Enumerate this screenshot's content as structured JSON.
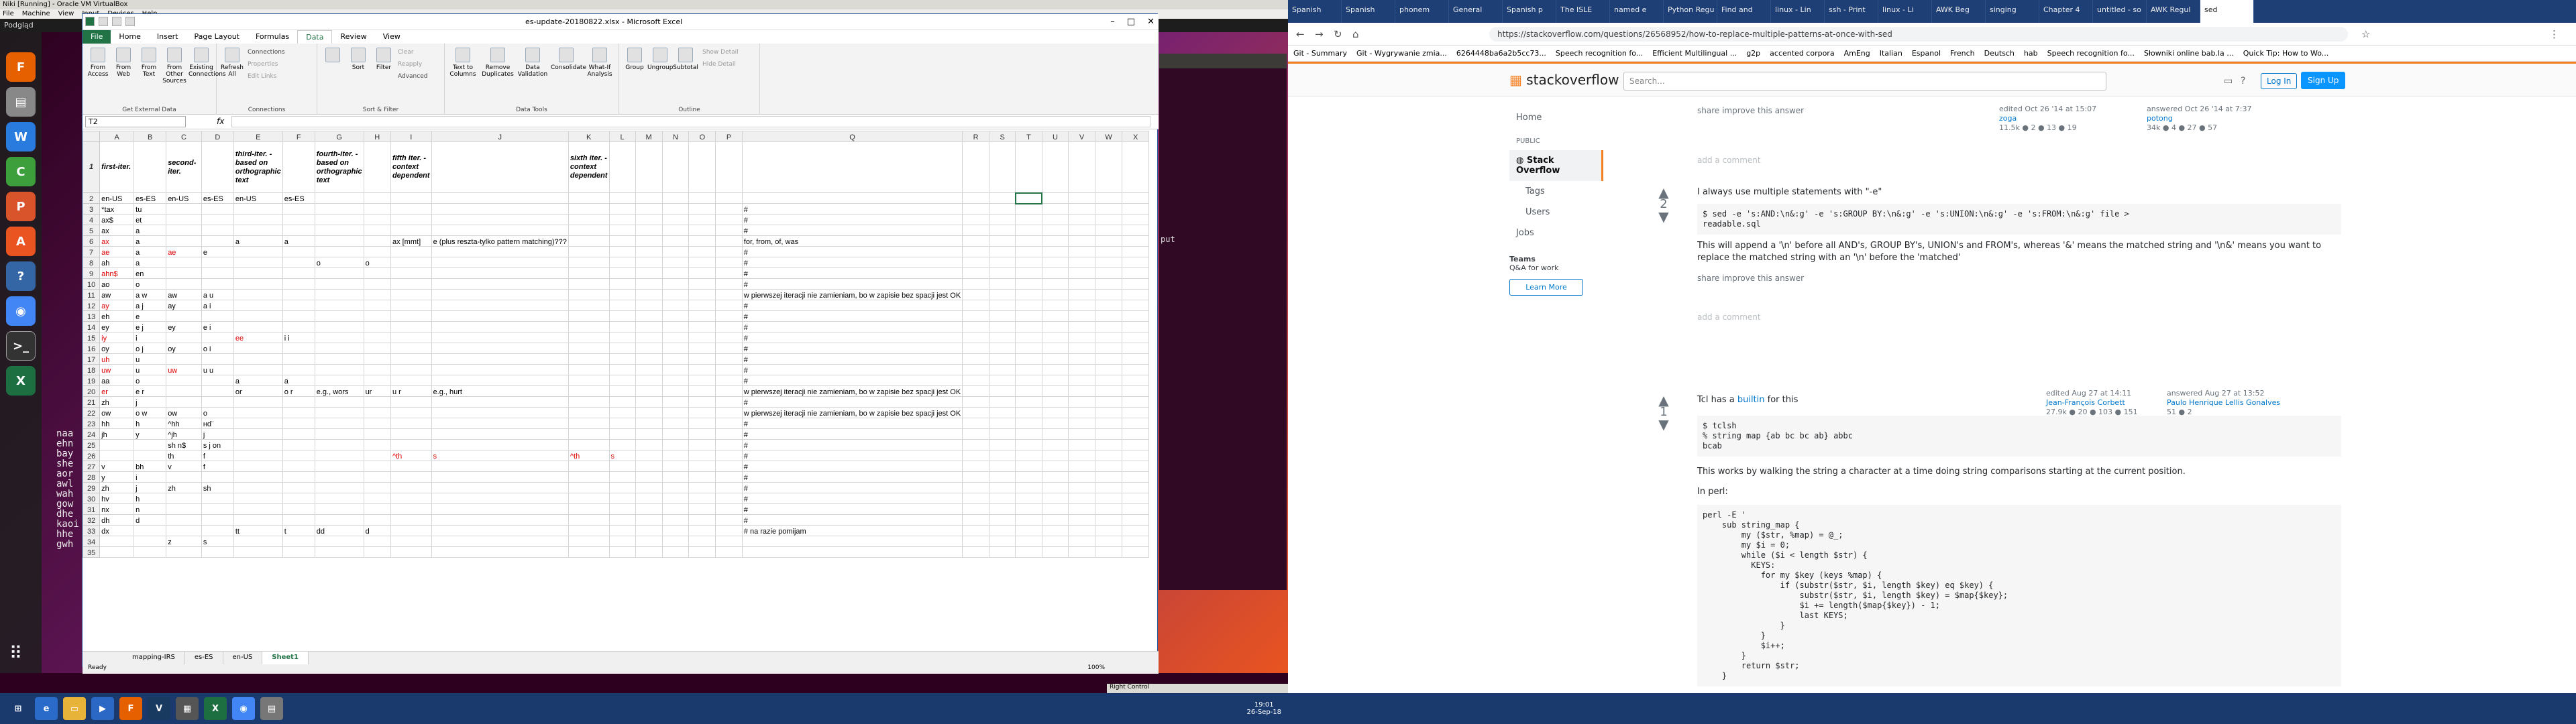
{
  "vbox": {
    "title": "Niki [Running] - Oracle VM VirtualBox",
    "menu": [
      "File",
      "Machine",
      "View",
      "Input",
      "Devices",
      "Help"
    ],
    "top_left": "Podgląd"
  },
  "terminal": {
    "left_text": [
      "naa",
      "ehn",
      "bay",
      "she",
      "aor",
      "awl",
      "wah",
      "gow",
      "dhe",
      "kaoi",
      "hhe",
      "gwh"
    ],
    "right_text": "put"
  },
  "excel": {
    "title": "es-update-20180822.xlsx - Microsoft Excel",
    "tabs": [
      "File",
      "Home",
      "Insert",
      "Page Layout",
      "Formulas",
      "Data",
      "Review",
      "View"
    ],
    "active_tab": "Data",
    "ribbon_groups": [
      {
        "label": "Get External Data",
        "buttons": [
          "From Access",
          "From Web",
          "From Text",
          "From Other Sources",
          "Existing Connections"
        ]
      },
      {
        "label": "Connections",
        "buttons": [
          "Refresh All"
        ],
        "small": [
          "Connections",
          "Properties",
          "Edit Links"
        ]
      },
      {
        "label": "Sort & Filter",
        "buttons": [
          "Sort",
          "Filter"
        ],
        "small": [
          "Clear",
          "Reapply",
          "Advanced"
        ]
      },
      {
        "label": "Data Tools",
        "buttons": [
          "Text to Columns",
          "Remove Duplicates",
          "Data Validation",
          "Consolidate",
          "What-If Analysis"
        ]
      },
      {
        "label": "Outline",
        "buttons": [
          "Group",
          "Ungroup",
          "Subtotal"
        ],
        "small": [
          "Show Detail",
          "Hide Detail"
        ]
      }
    ],
    "name_box": "T2",
    "fx": "fx",
    "columns": [
      "A",
      "B",
      "C",
      "D",
      "E",
      "F",
      "G",
      "H",
      "I",
      "J",
      "K",
      "L",
      "M",
      "N",
      "O",
      "P",
      "Q",
      "R",
      "S",
      "T",
      "U",
      "V",
      "W",
      "X"
    ],
    "header_row": [
      "first-iter.",
      "",
      "second-iter.",
      "",
      "third-iter. - based on orthographic text",
      "",
      "fourth-iter. - based on orthographic text",
      "",
      "fifth iter. - context dependent",
      "",
      "sixth iter. - context dependent"
    ],
    "rows": [
      [
        "en-US",
        "es-ES",
        "en-US",
        "es-ES",
        "en-US",
        "es-ES",
        "",
        "",
        "",
        "",
        "",
        "",
        "",
        "",
        "",
        ""
      ],
      [
        "*tax",
        "tu",
        "",
        "",
        "",
        "",
        "",
        "",
        "",
        "",
        "",
        "",
        "",
        "",
        "",
        "",
        "#"
      ],
      [
        "ax$",
        "et",
        "",
        "",
        "",
        "",
        "",
        "",
        "",
        "",
        "",
        "",
        "",
        "",
        "",
        "",
        "#"
      ],
      [
        "ax",
        "a",
        "",
        "",
        "",
        "",
        "",
        "",
        "",
        "",
        "",
        "",
        "",
        "",
        "",
        "",
        "#"
      ],
      [
        "ax",
        "a",
        "",
        "",
        "a",
        "a",
        "",
        "",
        "ax [mmt]",
        "e (plus reszta-tylko pattern matching)???",
        "",
        "",
        "",
        "",
        "",
        "",
        "for, from, of, was"
      ],
      [
        "ae",
        "a",
        "ae",
        "e",
        "",
        "",
        "",
        "",
        "",
        "",
        "",
        "",
        "",
        "",
        "",
        "",
        "#"
      ],
      [
        "ah",
        "a",
        "",
        "",
        "",
        "",
        "o",
        "o",
        "",
        "",
        "",
        "",
        "",
        "",
        "",
        "",
        "#"
      ],
      [
        "ahn$",
        "en",
        "",
        "",
        "",
        "",
        "",
        "",
        "",
        "",
        "",
        "",
        "",
        "",
        "",
        "",
        "#"
      ],
      [
        "ao",
        "o",
        "",
        "",
        "",
        "",
        "",
        "",
        "",
        "",
        "",
        "",
        "",
        "",
        "",
        "",
        "#"
      ],
      [
        "aw",
        "a w",
        "aw",
        "a u",
        "",
        "",
        "",
        "",
        "",
        "",
        "",
        "",
        "",
        "",
        "",
        "",
        "w pierwszej iteracji nie zamieniam, bo w zapisie bez spacji jest OK"
      ],
      [
        "ay",
        "a j",
        "ay",
        "a i",
        "",
        "",
        "",
        "",
        "",
        "",
        "",
        "",
        "",
        "",
        "",
        "",
        "#"
      ],
      [
        "eh",
        "e",
        "",
        "",
        "",
        "",
        "",
        "",
        "",
        "",
        "",
        "",
        "",
        "",
        "",
        "",
        "#"
      ],
      [
        "ey",
        "e j",
        "ey",
        "e i",
        "",
        "",
        "",
        "",
        "",
        "",
        "",
        "",
        "",
        "",
        "",
        "",
        "#"
      ],
      [
        "iy",
        "i",
        "",
        "",
        "ee",
        "i i",
        "",
        "",
        "",
        "",
        "",
        "",
        "",
        "",
        "",
        "",
        "#"
      ],
      [
        "oy",
        "o j",
        "oy",
        "o i",
        "",
        "",
        "",
        "",
        "",
        "",
        "",
        "",
        "",
        "",
        "",
        "",
        "#"
      ],
      [
        "uh",
        "u",
        "",
        "",
        "",
        "",
        "",
        "",
        "",
        "",
        "",
        "",
        "",
        "",
        "",
        "",
        "#"
      ],
      [
        "uw",
        "u",
        "uw",
        "u u",
        "",
        "",
        "",
        "",
        "",
        "",
        "",
        "",
        "",
        "",
        "",
        "",
        "#"
      ],
      [
        "aa",
        "o",
        "",
        "",
        "a",
        "a",
        "",
        "",
        "",
        "",
        "",
        "",
        "",
        "",
        "",
        "",
        "#"
      ],
      [
        "er",
        "e r",
        "",
        "",
        "or",
        "o r",
        "e.g., wors",
        "ur",
        "u r",
        "e.g., hurt",
        "",
        "",
        "",
        "",
        "",
        "",
        "w pierwszej iteracji nie zamieniam, bo w zapisie bez spacji jest OK"
      ],
      [
        "zh",
        "j",
        "",
        "",
        "",
        "",
        "",
        "",
        "",
        "",
        "",
        "",
        "",
        "",
        "",
        "",
        "#"
      ],
      [
        "ow",
        "o w",
        "ow",
        "o",
        "",
        "",
        "",
        "",
        "",
        "",
        "",
        "",
        "",
        "",
        "",
        "",
        "w pierwszej iteracji nie zamieniam, bo w zapisie bez spacji jest OK"
      ],
      [
        "hh",
        "h",
        "^hh",
        "ʜd¨",
        "",
        "",
        "",
        "",
        "",
        "",
        "",
        "",
        "",
        "",
        "",
        "",
        "#"
      ],
      [
        "jh",
        "y",
        "^jh",
        "j",
        "",
        "",
        "",
        "",
        "",
        "",
        "",
        "",
        "",
        "",
        "",
        "",
        "#"
      ],
      [
        "",
        "",
        "sh n$",
        "s j on",
        "",
        "",
        "",
        "",
        "",
        "",
        "",
        "",
        "",
        "",
        "",
        "",
        "#"
      ],
      [
        "",
        "",
        "th",
        "f",
        "",
        "",
        "",
        "",
        "^th",
        "s",
        "^th",
        "s",
        "",
        "",
        "",
        "",
        "#"
      ],
      [
        "v",
        "bh",
        "v",
        "f",
        "",
        "",
        "",
        "",
        "",
        "",
        "",
        "",
        "",
        "",
        "",
        "",
        "#"
      ],
      [
        "y",
        "i",
        "",
        "",
        "",
        "",
        "",
        "",
        "",
        "",
        "",
        "",
        "",
        "",
        "",
        "",
        "#"
      ],
      [
        "zh",
        "j",
        "zh",
        "sh",
        "",
        "",
        "",
        "",
        "",
        "",
        "",
        "",
        "",
        "",
        "",
        "",
        "#"
      ],
      [
        "hv",
        "h",
        "",
        "",
        "",
        "",
        "",
        "",
        "",
        "",
        "",
        "",
        "",
        "",
        "",
        "",
        "#"
      ],
      [
        "nx",
        "n",
        "",
        "",
        "",
        "",
        "",
        "",
        "",
        "",
        "",
        "",
        "",
        "",
        "",
        "",
        "#"
      ],
      [
        "dh",
        "d",
        "",
        "",
        "",
        "",
        "",
        "",
        "",
        "",
        "",
        "",
        "",
        "",
        "",
        "",
        "#"
      ],
      [
        "dx",
        "",
        "",
        "",
        "tt",
        "t",
        "dd",
        "d",
        "",
        "",
        "",
        "",
        "",
        "",
        "",
        "",
        "# na razie pomijam"
      ],
      [
        "",
        "",
        "z",
        "s",
        "",
        "",
        "",
        "",
        "",
        "",
        "",
        "",
        "",
        "",
        "",
        "",
        ""
      ],
      [
        "",
        "",
        "",
        "",
        "",
        "",
        "",
        "",
        "",
        "",
        "",
        "",
        "",
        "",
        "",
        "",
        ""
      ]
    ],
    "red_rows": [
      6,
      7,
      9,
      12,
      15,
      17,
      18,
      20
    ],
    "sheet_tabs": [
      "mapping-IRS",
      "es-ES",
      "en-US",
      "Sheet1"
    ],
    "active_sheet": "Sheet1",
    "status": "Ready",
    "zoom": "100%"
  },
  "browser": {
    "tabs": [
      "Spanish",
      "Spanish",
      "phonem",
      "General",
      "Spanish p",
      "The ISLE",
      "named e",
      "Python Regu",
      "Find and",
      "linux - Lin",
      "ssh - Print",
      "linux - Li",
      "AWK Beg",
      "singing",
      "Chapter 4",
      "untitled - so",
      "AWK Regul",
      "sed"
    ],
    "url": "https://stackoverflow.com/questions/26568952/how-to-replace-multiple-patterns-at-once-with-sed",
    "bookmarks": [
      "Git - Summary",
      "Git - Wygrywanie zmia...",
      "6264448ba6a2b5cc73...",
      "Speech recognition fo...",
      "Efficient Multilingual ...",
      "g2p",
      "accented corpora",
      "AmEng",
      "Italian",
      "Espanol",
      "French",
      "Deutsch",
      "hab",
      "Speech recognition fo...",
      "Słowniki online bab.la ...",
      "Quick Tip: How to Wo..."
    ]
  },
  "so": {
    "logo": "stackoverflow",
    "search_placeholder": "Search...",
    "login": "Log In",
    "signup": "Sign Up",
    "nav": [
      "Home",
      "PUBLIC",
      "Stack Overflow",
      "Tags",
      "Users",
      "Jobs"
    ],
    "teams_title": "Teams",
    "teams_sub": "Q&A for work",
    "learn_more": "Learn More",
    "post1": {
      "menu": "share  improve this answer",
      "edited": "edited Oct 26 '14 at 15:07",
      "edited_user": "zoga",
      "edited_rep": "11.5k ● 2 ● 13 ● 19",
      "answered": "answered Oct 26 '14 at 7:37",
      "answered_user": "potong",
      "answered_rep": "34k ● 4 ● 27 ● 57",
      "comment": "add a comment"
    },
    "post2": {
      "votes": "2",
      "p1": "I always use multiple statements with \"-e\"",
      "code": "$ sed -e 's:AND:\\n&:g' -e 's:GROUP BY:\\n&:g' -e 's:UNION:\\n&:g' -e 's:FROM:\\n&:g' file >\nreadable.sql",
      "p2": "This will append a '\\n' before all AND's, GROUP BY's, UNION's and FROM's, whereas '&' means the matched string and '\\n&' means you want to replace the matched string with an '\\n' before the 'matched'",
      "menu": "share  improve this answer",
      "edited": "edited Aug 27 at 14:11",
      "edited_user": "Jean-François Corbett",
      "edited_rep": "27.9k ● 20 ● 103 ● 151",
      "answered": "answered Aug 27 at 13:52",
      "answered_user": "Paulo Henrique Lellis Gonalves",
      "answered_rep": "51 ● 2",
      "comment": "add a comment"
    },
    "post3": {
      "votes": "1",
      "p1_pre": "Tcl has a ",
      "p1_link": "builtin",
      "p1_post": " for this",
      "code1": "$ tclsh\n% string map {ab bc bc ab} abbc\nbcab",
      "p2": "This works by walking the string a character at a time doing string comparisons starting at the current position.",
      "p3": "In perl:",
      "code2": "perl -E '\n    sub string_map {\n        my ($str, %map) = @_;\n        my $i = 0;\n        while ($i < length $str) {\n          KEYS:\n            for my $key (keys %map) {\n                if (substr($str, $i, length $key) eq $key) {\n                    substr($str, $i, length $key) = $map{$key};\n                    $i += length($map{$key}) - 1;\n                    last KEYS;\n                }\n            }\n            $i++;\n        }\n        return $str;\n    }"
    }
  },
  "taskbar": {
    "clock_time": "19:01",
    "clock_date": "26-Sep-18",
    "right_control": "Right Control"
  }
}
